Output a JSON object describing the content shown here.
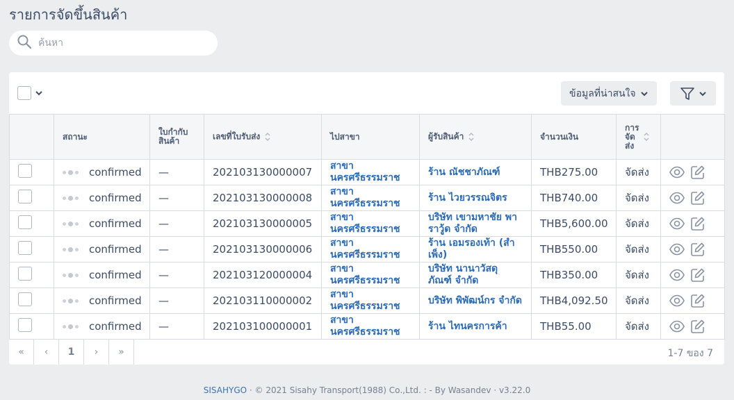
{
  "page": {
    "title": "รายการจัดขึ้นสินค้า"
  },
  "search": {
    "placeholder": "ค้นหา"
  },
  "toolbar": {
    "interest_label": "ข้อมูลที่น่าสนใจ",
    "icons": [
      "chevron-down-icon",
      "filter-icon"
    ]
  },
  "table": {
    "headers": {
      "status": "สถานะ",
      "invoice": "ใบกำกับ\nสินค้า",
      "receipt": "เลขที่ใบรับส่ง",
      "branch": "ไปสาขา",
      "receiver": "ผู้รับสินค้า",
      "amount": "จำนวนเงิน",
      "delivery": "การ\nจัด\nส่ง"
    },
    "rows": [
      {
        "status": "confirmed",
        "invoice": "—",
        "receipt": "202103130000007",
        "branch": "สาขา นครศรีธรรมราช",
        "receiver": "ร้าน ณัชชาภัณฑ์",
        "amount": "THB275.00",
        "delivery": "จัดส่ง"
      },
      {
        "status": "confirmed",
        "invoice": "—",
        "receipt": "202103130000008",
        "branch": "สาขา นครศรีธรรมราช",
        "receiver": "ร้าน ไวยวรรณจิตร",
        "amount": "THB740.00",
        "delivery": "จัดส่ง"
      },
      {
        "status": "confirmed",
        "invoice": "—",
        "receipt": "202103130000005",
        "branch": "สาขา นครศรีธรรมราช",
        "receiver": "บริษัท เขามหาชัย พาราวู้ด จำกัด",
        "amount": "THB5,600.00",
        "delivery": "จัดส่ง"
      },
      {
        "status": "confirmed",
        "invoice": "—",
        "receipt": "202103130000006",
        "branch": "สาขา นครศรีธรรมราช",
        "receiver": "ร้าน เอมรองเท้า (สำเพ็ง)",
        "amount": "THB550.00",
        "delivery": "จัดส่ง"
      },
      {
        "status": "confirmed",
        "invoice": "—",
        "receipt": "202103120000004",
        "branch": "สาขา นครศรีธรรมราช",
        "receiver": "บริษัท นานาวัสดุ ภัณฑ์ จำกัด",
        "amount": "THB350.00",
        "delivery": "จัดส่ง"
      },
      {
        "status": "confirmed",
        "invoice": "—",
        "receipt": "202103110000002",
        "branch": "สาขา นครศรีธรรมราช",
        "receiver": "บริษัท พิพัฒน์กร จำกัด",
        "amount": "THB4,092.50",
        "delivery": "จัดส่ง"
      },
      {
        "status": "confirmed",
        "invoice": "—",
        "receipt": "202103100000001",
        "branch": "สาขา นครศรีธรรมราช",
        "receiver": "ร้าน ไทนครการค้า",
        "amount": "THB55.00",
        "delivery": "จัดส่ง"
      }
    ]
  },
  "pagination": {
    "first": "«",
    "prev": "‹",
    "current": "1",
    "next": "›",
    "last": "»",
    "count_text": "1-7 ของ 7"
  },
  "footer": {
    "brand": "SISAHYGO",
    "sep1": " · ",
    "copyright": "© 2021 Sisahy Transport(1988) Co.,Ltd. : - By Wasandev",
    "sep2": " · ",
    "version": "v3.22.0"
  },
  "colors": {
    "link": "#2c6bb5",
    "background": "#ebedef",
    "text": "#3c4b64"
  }
}
